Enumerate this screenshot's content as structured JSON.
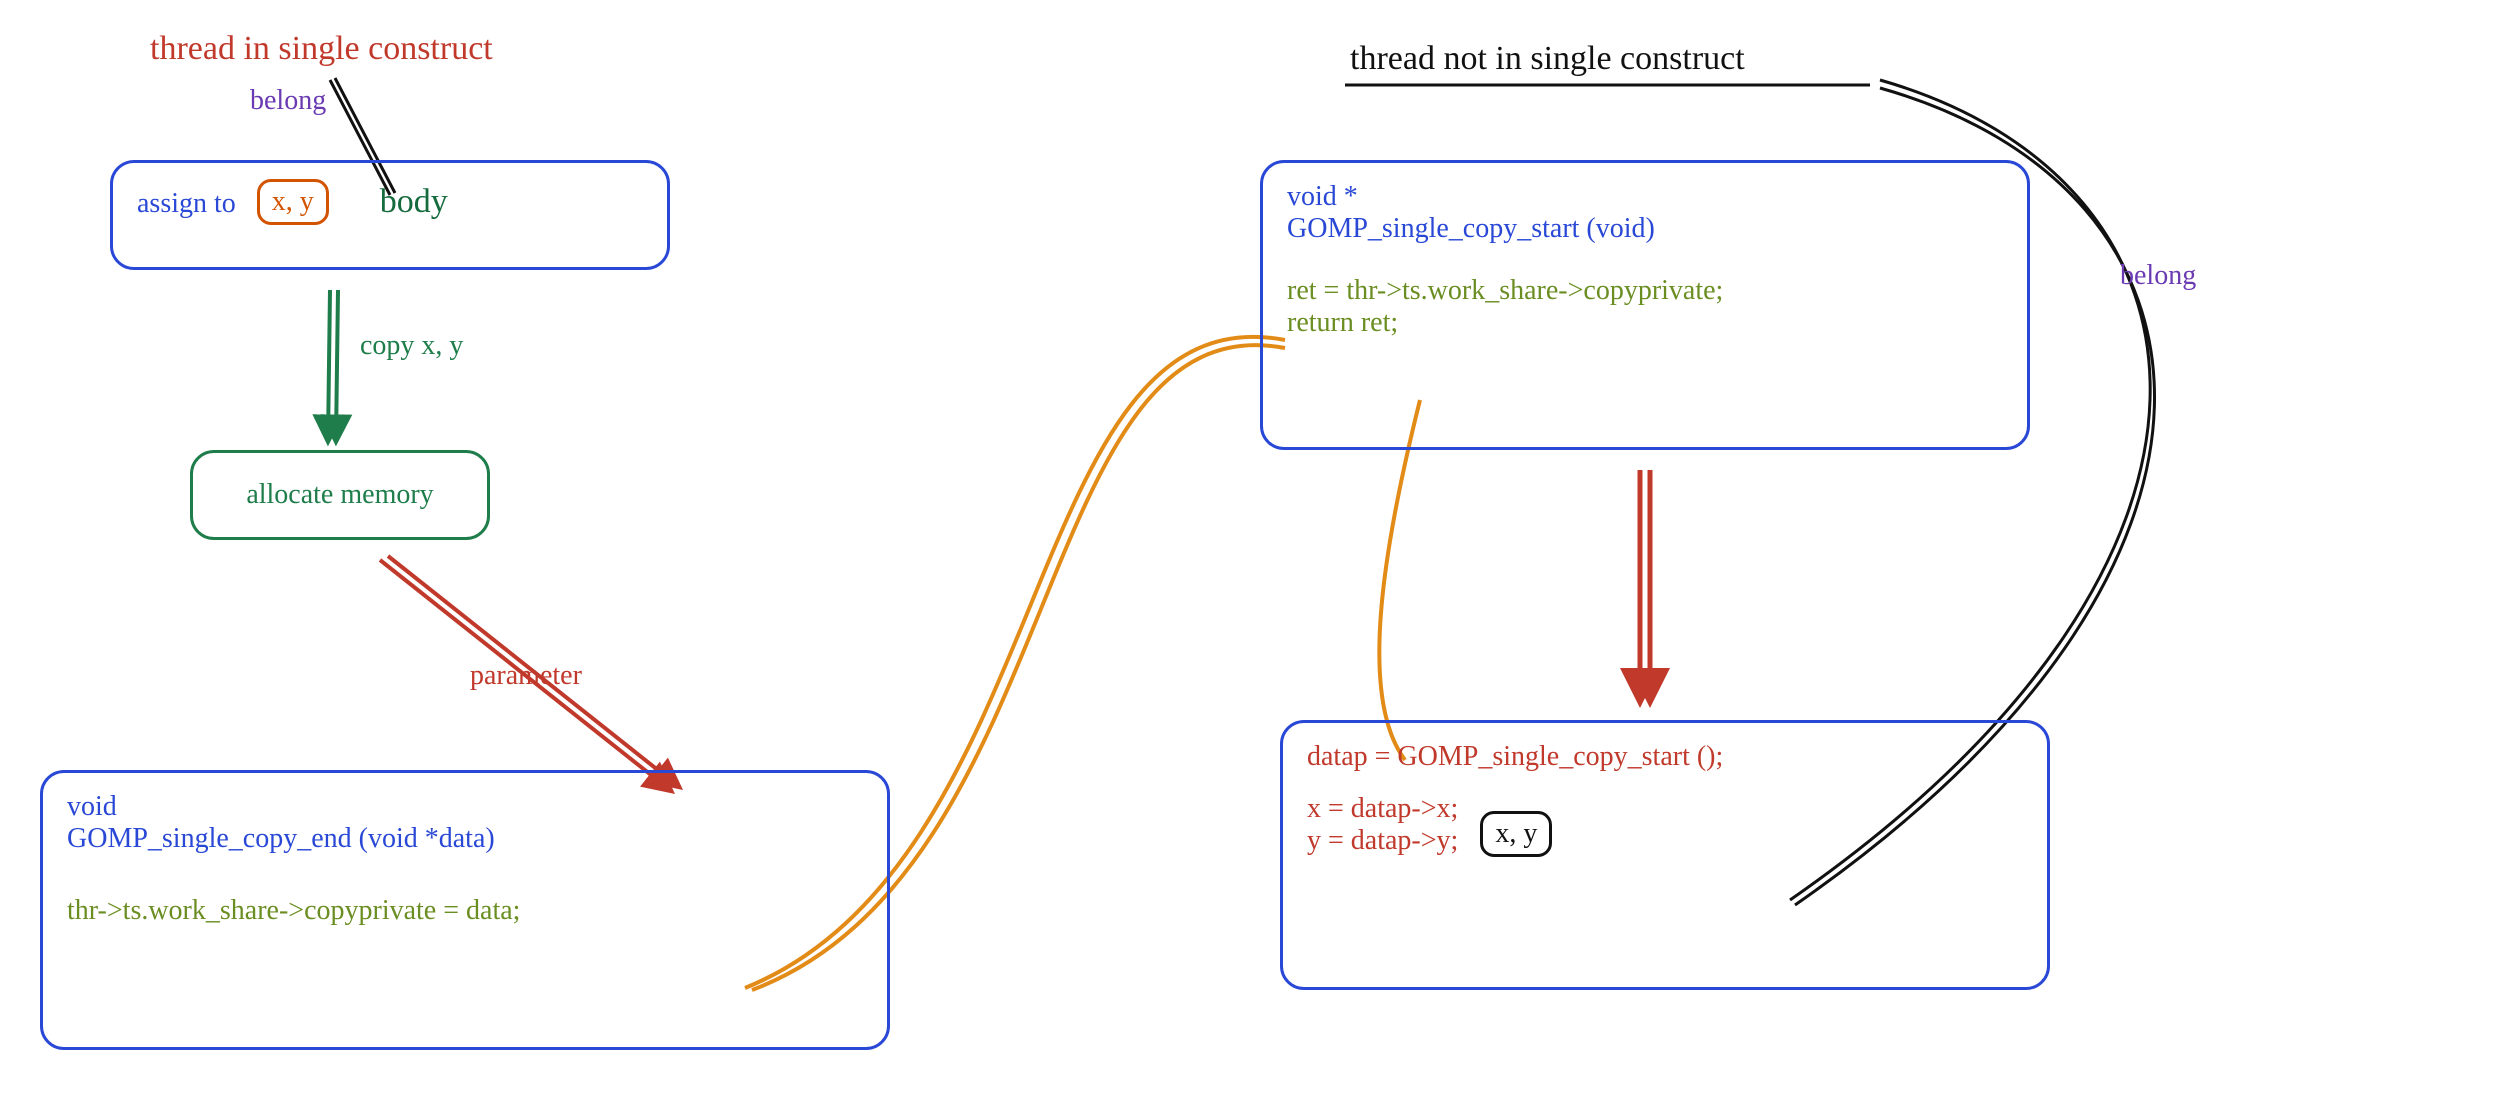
{
  "left": {
    "title": "thread in single construct",
    "belong": "belong",
    "body_box": {
      "assign": "assign to",
      "xy": "x, y",
      "body": "body"
    },
    "arrow1_label": "copy x, y",
    "alloc_box": "allocate memory",
    "arrow2_label": "parameter",
    "end_box": {
      "sig1": "void",
      "sig2": "GOMP_single_copy_end (void *data)",
      "stmt": "thr->ts.work_share->copyprivate = data;"
    }
  },
  "right": {
    "title": "thread not in single construct",
    "belong": "belong",
    "start_box": {
      "sig1": "void *",
      "sig2": "GOMP_single_copy_start (void)",
      "stmt1": "ret = thr->ts.work_share->copyprivate;",
      "stmt2": "return ret;"
    },
    "use_box": {
      "line1": "datap = GOMP_single_copy_start ();",
      "line2": "x = datap->x;",
      "line3": "y = datap->y;",
      "xy": "x, y"
    }
  }
}
